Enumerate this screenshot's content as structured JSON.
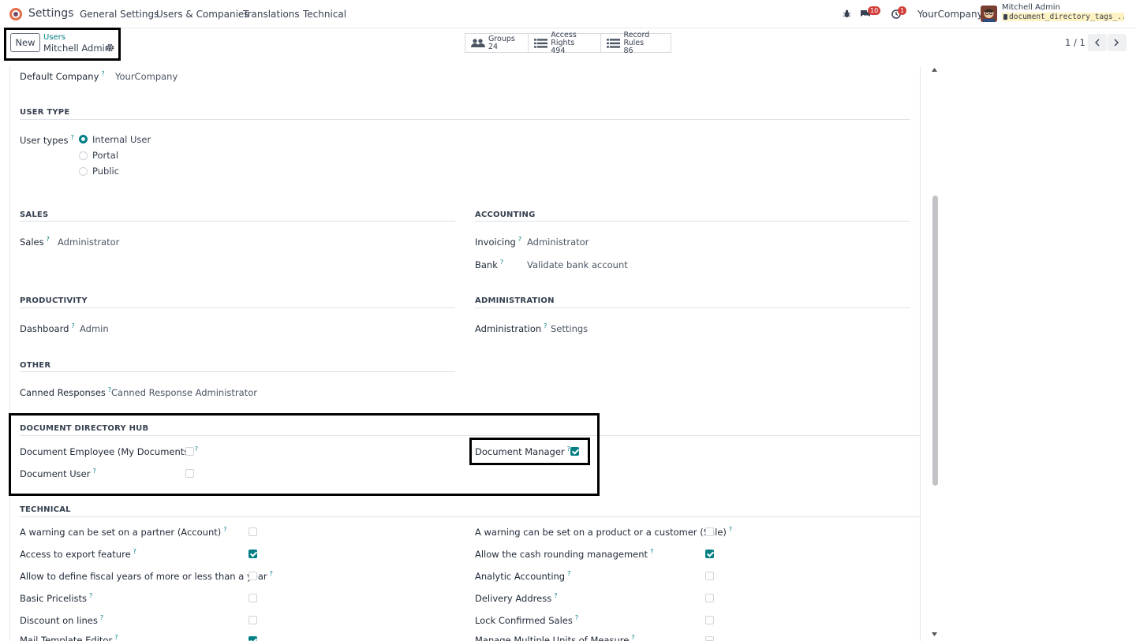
{
  "navbar": {
    "app_name": "Settings",
    "menu": [
      "General Settings",
      "Users & Companies",
      "Translations",
      "Technical"
    ],
    "messages_count": "10",
    "activities_count": "1",
    "company": "YourCompany",
    "user_name": "Mitchell Admin",
    "database": "document_directory_tags_..."
  },
  "control": {
    "new_label": "New",
    "breadcrumb_parent": "Users",
    "breadcrumb_current": "Mitchell Admin",
    "smart_buttons": [
      {
        "label": "Groups",
        "count": "24"
      },
      {
        "label": "Access Rights",
        "count": "494"
      },
      {
        "label": "Record Rules",
        "count": "86"
      }
    ],
    "pager": "1 / 1"
  },
  "form": {
    "default_company_label": "Default Company",
    "default_company_value": "YourCompany",
    "q": "?",
    "user_type": {
      "title": "USER TYPE",
      "label": "User types",
      "options": [
        "Internal User",
        "Portal",
        "Public"
      ],
      "selected": "Internal User"
    },
    "sales": {
      "title": "SALES",
      "label": "Sales",
      "value": "Administrator"
    },
    "accounting": {
      "title": "ACCOUNTING",
      "invoicing_label": "Invoicing",
      "invoicing_value": "Administrator",
      "bank_label": "Bank",
      "bank_value": "Validate bank account"
    },
    "productivity": {
      "title": "PRODUCTIVITY",
      "label": "Dashboard",
      "value": "Admin"
    },
    "administration": {
      "title": "ADMINISTRATION",
      "label": "Administration",
      "value": "Settings"
    },
    "other": {
      "title": "OTHER",
      "label": "Canned Responses",
      "value": "Canned Response Administrator"
    },
    "document_hub": {
      "title": "DOCUMENT DIRECTORY HUB",
      "employee_label": "Document Employee (My Documents)",
      "employee_checked": false,
      "user_label": "Document User",
      "user_checked": false,
      "manager_label": "Document Manager",
      "manager_checked": true
    },
    "technical": {
      "title": "TECHNICAL",
      "left": [
        {
          "label": "A warning can be set on a partner (Account)",
          "checked": false
        },
        {
          "label": "Access to export feature",
          "checked": true
        },
        {
          "label": "Allow to define fiscal years of more or less than a year",
          "checked": false
        },
        {
          "label": "Basic Pricelists",
          "checked": false
        },
        {
          "label": "Discount on lines",
          "checked": false
        },
        {
          "label": "Mail Template Editor",
          "checked": true
        }
      ],
      "right": [
        {
          "label": "A warning can be set on a product or a customer (Sale)",
          "checked": false
        },
        {
          "label": "Allow the cash rounding management",
          "checked": true
        },
        {
          "label": "Analytic Accounting",
          "checked": false
        },
        {
          "label": "Delivery Address",
          "checked": false
        },
        {
          "label": "Lock Confirmed Sales",
          "checked": false
        },
        {
          "label": "Manage Multiple Units of Measure",
          "checked": false
        }
      ]
    }
  },
  "colors": {
    "accent": "#017e84",
    "brand": "#714b67",
    "badge": "#d23f3a"
  }
}
